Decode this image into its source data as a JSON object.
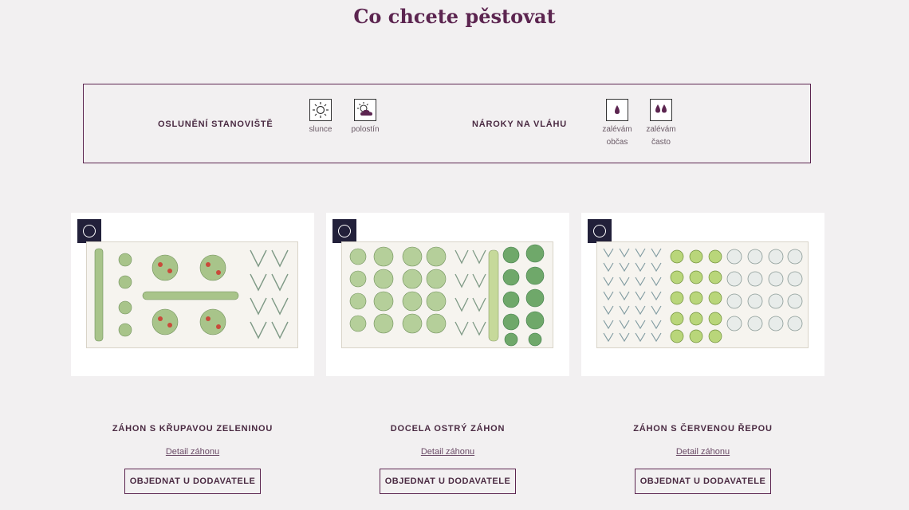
{
  "page_title": "Co chcete pěstovat",
  "filters": {
    "sun": {
      "label": "OSLUNĚNÍ STANOVIŠTĚ",
      "options": [
        {
          "label": "slunce",
          "icon": "sun-icon"
        },
        {
          "label": "polostín",
          "icon": "partly-cloudy-icon"
        }
      ]
    },
    "moisture": {
      "label": "NÁROKY NA VLÁHU",
      "options": [
        {
          "label_line1": "zalévám",
          "label_line2": "občas",
          "icon": "single-drop-icon"
        },
        {
          "label_line1": "zalévám",
          "label_line2": "často",
          "icon": "double-drop-icon"
        }
      ]
    }
  },
  "cards": [
    {
      "title": "ZÁHON S KŘUPAVOU ZELENINOU",
      "link": "Detail záhonu",
      "button": "OBJEDNAT U DODAVATELE"
    },
    {
      "title": "DOCELA OSTRÝ ZÁHON",
      "link": "Detail záhonu",
      "button": "OBJEDNAT U DODAVATELE"
    },
    {
      "title": "ZÁHON S ČERVENOU ŘEPOU",
      "link": "Detail záhonu",
      "button": "OBJEDNAT U DODAVATELE"
    }
  ],
  "colors": {
    "accent": "#5c2550",
    "background": "#f2f0f1",
    "check_bg": "#22203a"
  }
}
